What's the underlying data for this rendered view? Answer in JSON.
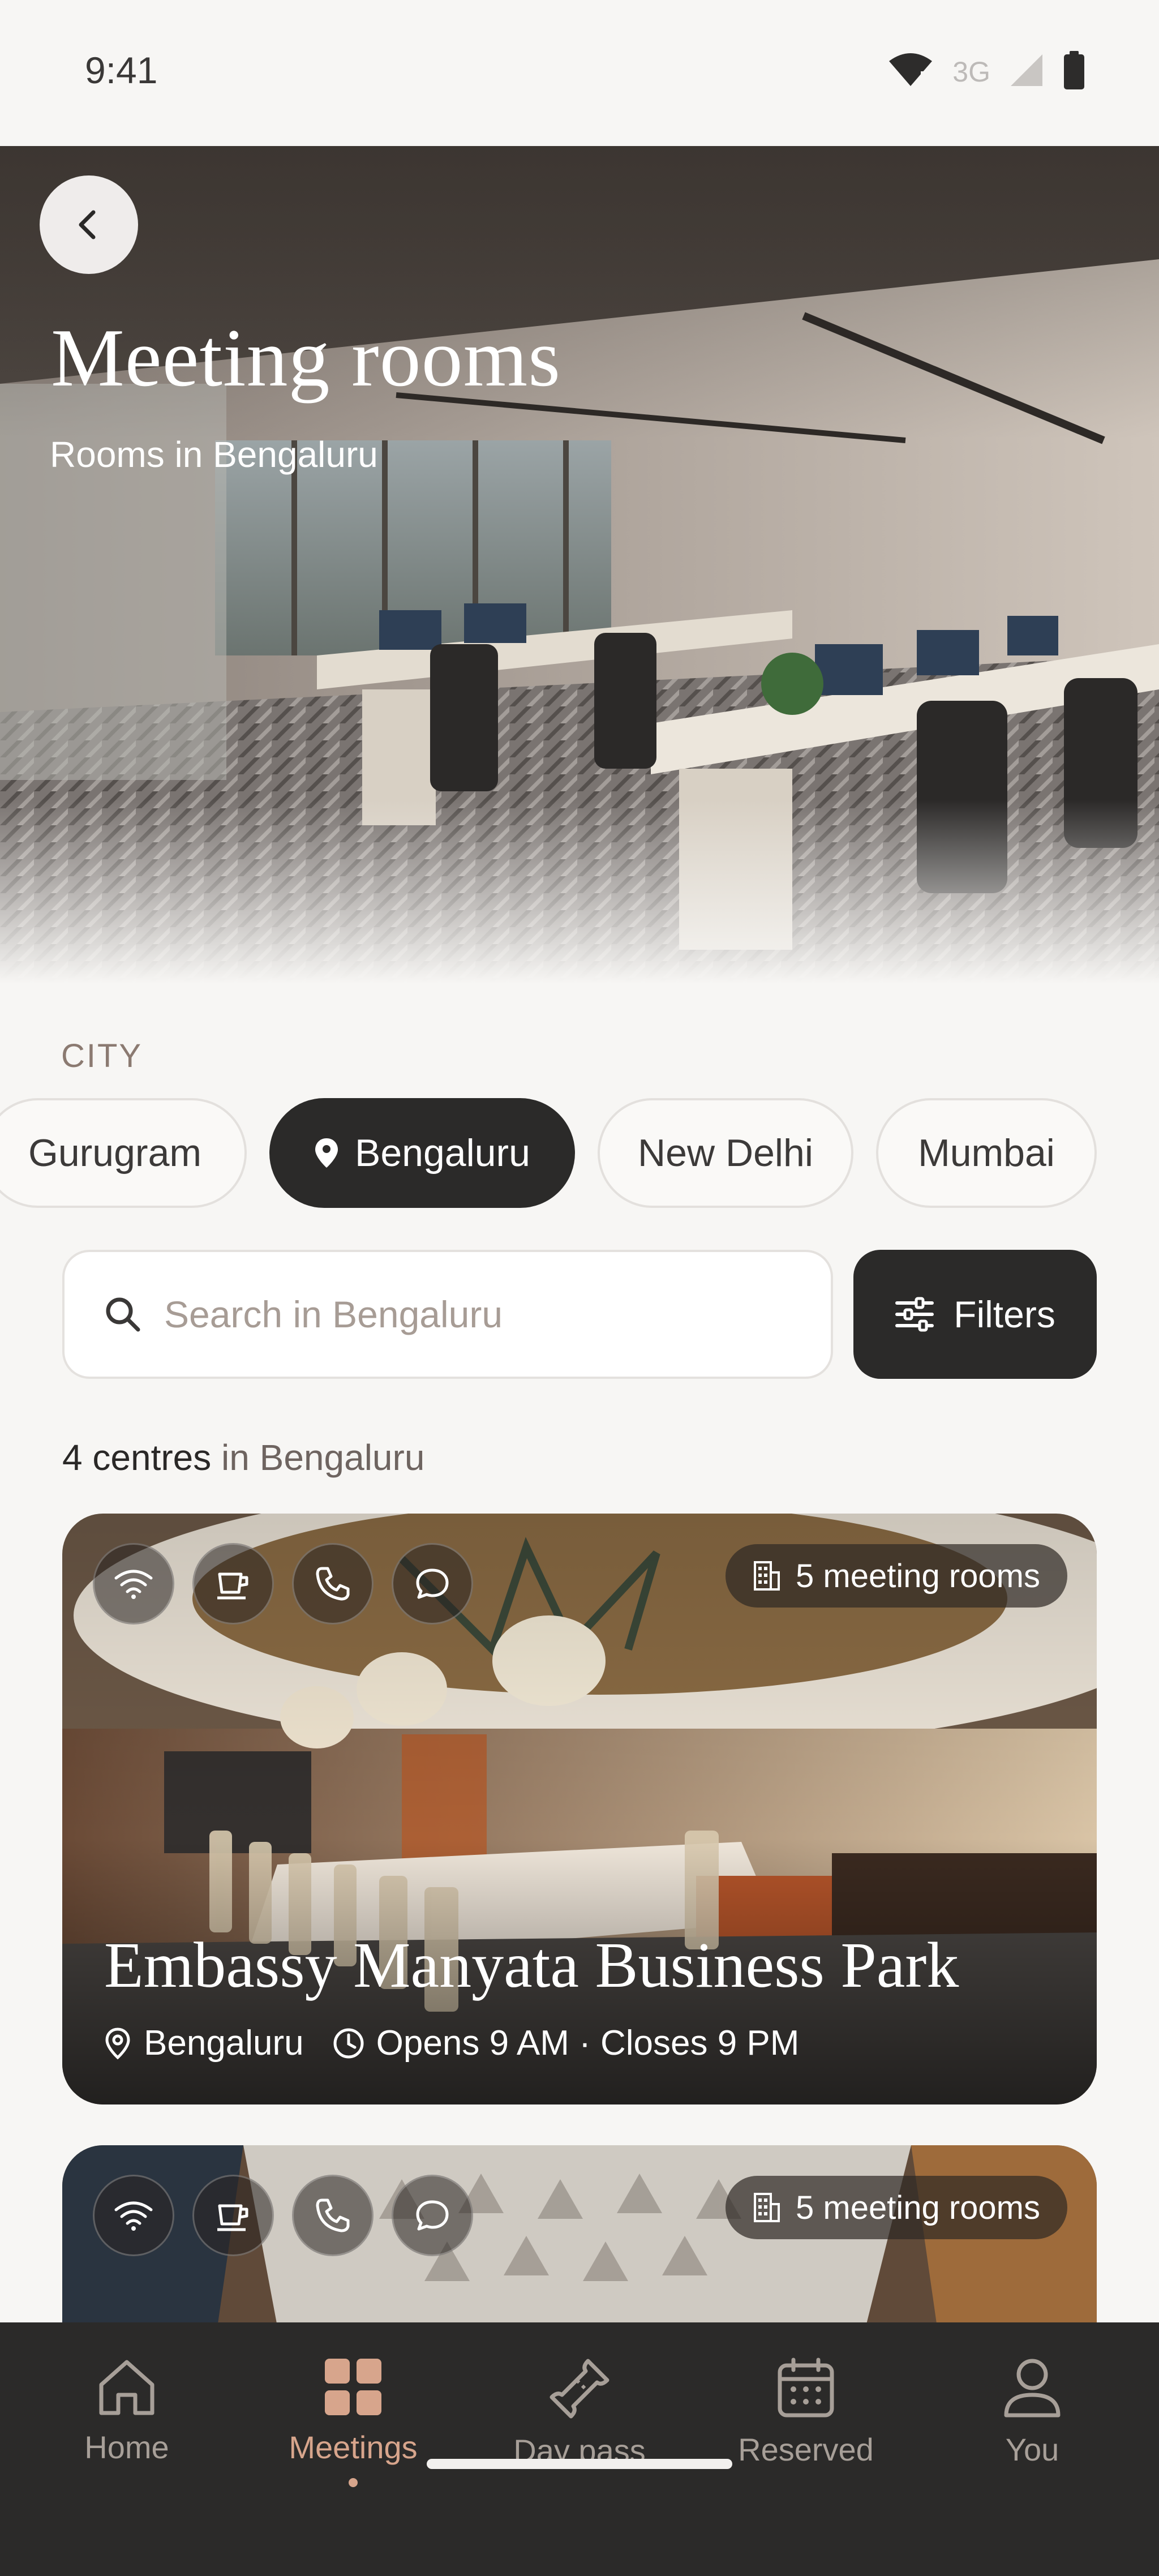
{
  "status_bar": {
    "time": "9:41",
    "network": "3G"
  },
  "header": {
    "title": "Meeting rooms",
    "subtitle": "Rooms in Bengaluru"
  },
  "city": {
    "label": "CITY",
    "chips": [
      {
        "label": "Gurugram",
        "active": false
      },
      {
        "label": "Bengaluru",
        "active": true
      },
      {
        "label": "New Delhi",
        "active": false
      },
      {
        "label": "Mumbai",
        "active": false
      }
    ]
  },
  "search": {
    "placeholder": "Search in Bengaluru",
    "value": ""
  },
  "filters": {
    "label": "Filters"
  },
  "results": {
    "count": "4 centres",
    "suffix": " in Bengaluru"
  },
  "centres": [
    {
      "name": "Embassy Manyata Business Park",
      "rooms_badge": "5 meeting rooms",
      "city": "Bengaluru",
      "hours": "Opens 9 AM · Closes 9 PM",
      "amenities": [
        "wifi-icon",
        "coffee-icon",
        "phone-icon",
        "chat-icon"
      ]
    },
    {
      "rooms_badge": "5 meeting rooms",
      "amenities": [
        "wifi-icon",
        "coffee-icon",
        "phone-icon",
        "chat-icon"
      ]
    }
  ],
  "nav": {
    "items": [
      {
        "label": "Home",
        "icon": "home-icon",
        "active": false
      },
      {
        "label": "Meetings",
        "icon": "grid-icon",
        "active": true
      },
      {
        "label": "Day pass",
        "icon": "ticket-icon",
        "active": false
      },
      {
        "label": "Reserved",
        "icon": "calendar-icon",
        "active": false
      },
      {
        "label": "You",
        "icon": "person-icon",
        "active": false
      }
    ]
  },
  "colors": {
    "accent": "#d7a58c",
    "dark": "#2b2a29",
    "background": "#f7f6f4"
  }
}
